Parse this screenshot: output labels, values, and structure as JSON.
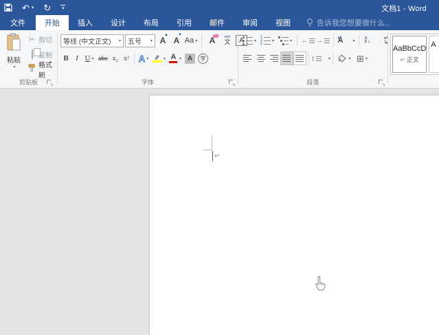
{
  "colors": {
    "titlebar": "#2b579a",
    "accent": "#2b579a",
    "ribbon_bg": "#f5f6f7",
    "doc_bg": "#e4e4e4",
    "page_bg": "#ffffff",
    "highlight_yellow": "#ffff00",
    "font_color_red": "#e00000"
  },
  "titlebar": {
    "title": "文档1 - Word"
  },
  "glyphs": {
    "caret": "▾",
    "undo": "↶",
    "redo": "↻",
    "scissors": "✂",
    "up_tick": "▲",
    "down_tick": "▼",
    "launcher_arrow": "↘",
    "outdent_arrow": "←",
    "indent_arrow": "→",
    "asian_arrows": "⇄",
    "sort_down": "↓",
    "marks_top": "↵",
    "marks_bottom": "↳",
    "updown": "↕",
    "borders_grid": "⊞",
    "list_numbers": [
      "1",
      "2",
      "3"
    ]
  },
  "tabs": {
    "file": "文件",
    "items": [
      "开始",
      "插入",
      "设计",
      "布局",
      "引用",
      "邮件",
      "审阅",
      "视图"
    ],
    "active": "开始",
    "tell_me": "告诉我您想要做什么..."
  },
  "ribbon": {
    "clipboard": {
      "group_label": "剪贴板",
      "paste_label": "粘贴",
      "cut_label": "剪切",
      "copy_label": "复制",
      "format_painter_label": "格式刷"
    },
    "font": {
      "group_label": "字体",
      "font_name": "等线 (中文正文)",
      "font_size": "五号",
      "grow_letter": "A",
      "shrink_letter": "A",
      "change_case": "Aa",
      "bold": "B",
      "italic": "I",
      "underline": "U",
      "strikethrough": "abc",
      "subscript": "x₂",
      "superscript": "x²",
      "text_effects_letter": "A",
      "font_color_letter": "A",
      "char_shading_letter": "A",
      "enclose_char": "字",
      "clear_format_letter": "A",
      "pinyin_top": "wén",
      "pinyin_bottom": "文",
      "char_border_letter": "A"
    },
    "paragraph": {
      "group_label": "段落",
      "asian_layout_letter": "A",
      "sort_top": "A",
      "sort_bottom": "2"
    },
    "styles": {
      "style1_preview": "AaBbCcD",
      "style1_return": "↵",
      "style1_name": "正文",
      "style2_preview_partial": "A"
    }
  }
}
